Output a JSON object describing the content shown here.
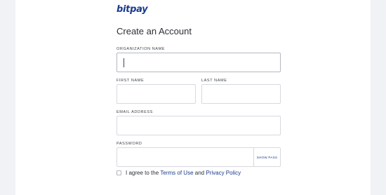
{
  "brand": {
    "logo_text": "bitpay"
  },
  "page_title": "Create an Account",
  "form": {
    "organization": {
      "label": "ORGANIZATION NAME",
      "value": ""
    },
    "first_name": {
      "label": "FIRST NAME",
      "value": ""
    },
    "last_name": {
      "label": "LAST NAME",
      "value": ""
    },
    "email": {
      "label": "EMAIL ADDRESS",
      "value": ""
    },
    "password": {
      "label": "PASSWORD",
      "value": "",
      "show_label": "SHOW PASS"
    },
    "agree": {
      "prefix": "I agree to the",
      "terms": "Terms of Use",
      "and": "and",
      "privacy": "Privacy Policy",
      "checked": false
    }
  },
  "colors": {
    "brand": "#1a3b8b",
    "side_panel": "#f1f2f6",
    "border": "#d6d9df"
  }
}
